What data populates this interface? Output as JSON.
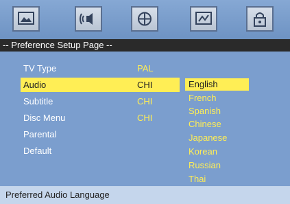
{
  "header": {
    "title": "-- Preference Setup Page --"
  },
  "toolbar": {
    "icons": [
      "general-setup-icon",
      "audio-setup-icon",
      "video-setup-icon",
      "preference-setup-icon",
      "password-setup-icon"
    ]
  },
  "settings": [
    {
      "label": "TV Type",
      "value": "PAL"
    },
    {
      "label": "Audio",
      "value": "CHI"
    },
    {
      "label": "Subtitle",
      "value": "CHI"
    },
    {
      "label": "Disc Menu",
      "value": "CHI"
    },
    {
      "label": "Parental",
      "value": ""
    },
    {
      "label": "Default",
      "value": ""
    }
  ],
  "selected_setting": "Audio",
  "options": [
    "English",
    "French",
    "Spanish",
    "Chinese",
    "Japanese",
    "Korean",
    "Russian",
    "Thai"
  ],
  "selected_option": "English",
  "footer": {
    "hint": "Preferred Audio Language"
  },
  "colors": {
    "highlight": "#ffee55",
    "panel": "#7b9ece",
    "header": "#2a2a2a",
    "footer": "#c5d6ec"
  }
}
